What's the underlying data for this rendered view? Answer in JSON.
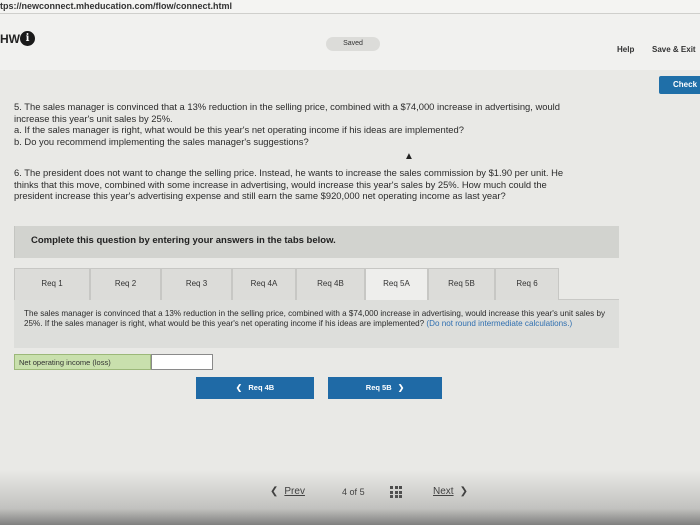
{
  "browser": {
    "url": "tps://newconnect.mheducation.com/flow/connect.html"
  },
  "header": {
    "title": "HW",
    "info_glyph": "i",
    "status": "Saved",
    "help_label": "Help",
    "save_exit_label": "Save & Exit",
    "check_label": "Check"
  },
  "question5": {
    "line1": "5. The sales manager is convinced that a 13% reduction in the selling price, combined with a $74,000 increase in advertising, would",
    "line2": "increase this year's unit sales by 25%.",
    "line3": "a. If the sales manager is right, what would be this year's net operating income if his ideas are implemented?",
    "line4": "b. Do you recommend implementing the sales manager's suggestions?"
  },
  "question6": {
    "line1": "6. The president does not want to change the selling price. Instead, he wants to increase the sales commission by $1.90 per unit. He",
    "line2": "thinks that this move, combined with some increase in advertising, would increase this year's sales by 25%. How much could the",
    "line3": "president increase this year's advertising expense and still earn the same $920,000 net operating income as last year?"
  },
  "instructions": "Complete this question by entering your answers in the tabs below.",
  "tabs": [
    {
      "label": "Req 1"
    },
    {
      "label": "Req 2"
    },
    {
      "label": "Req 3"
    },
    {
      "label": "Req 4A"
    },
    {
      "label": "Req 4B"
    },
    {
      "label": "Req 5A",
      "active": true
    },
    {
      "label": "Req 5B"
    },
    {
      "label": "Req 6"
    }
  ],
  "content": {
    "text": "The sales manager is convinced that a 13% reduction in the selling price, combined with a $74,000 increase in advertising, would increase this year's unit sales by 25%. If the sales manager is right, what would be this year's net operating income if his ideas are implemented?",
    "hint": "(Do not round intermediate calculations.)"
  },
  "answer": {
    "label": "Net operating income (loss)",
    "value": ""
  },
  "nav": {
    "prev_label": "Req 4B",
    "next_label": "Req 5B"
  },
  "pager": {
    "prev": "Prev",
    "current": "4",
    "of": "of",
    "total": "5",
    "next": "Next"
  },
  "colors": {
    "primary_blue": "#1f6aa6",
    "answer_label_green": "#c9e0ad",
    "hint_blue": "#2f6fb0"
  }
}
